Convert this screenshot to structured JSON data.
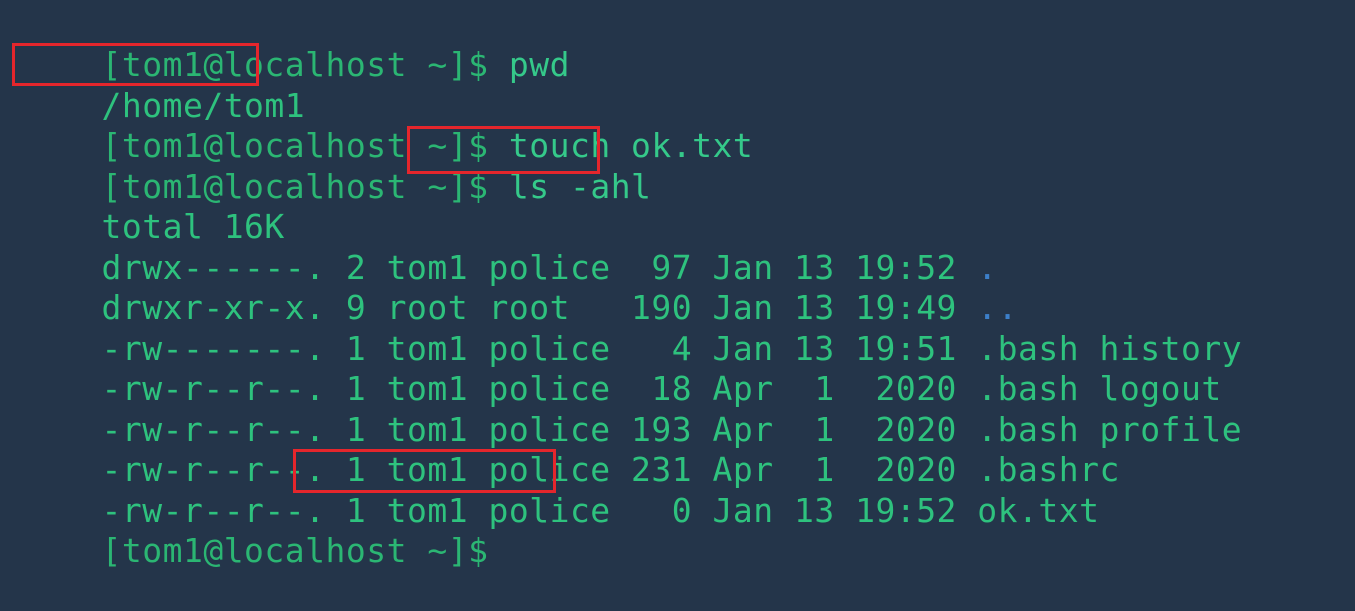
{
  "terminal": {
    "lines": [
      {
        "prompt": "[tom1@localhost ~]$",
        "command": " pwd"
      },
      {
        "output": "/home/tom1"
      },
      {
        "prompt": "[tom1@localhost ~]$",
        "command": " touch ok.txt"
      },
      {
        "prompt": "[tom1@localhost ~]$",
        "command": " ls -ahl"
      },
      {
        "output": "total 16K"
      },
      {
        "output": "drwx------. 2 tom1 police  97 Jan 13 19:52 ",
        "name": "."
      },
      {
        "output": "drwxr-xr-x. 9 root root   190 Jan 13 19:49 ",
        "name": ".."
      },
      {
        "output": "-rw-------. 1 tom1 police   4 Jan 13 19:51 .bash history"
      },
      {
        "output": "-rw-r--r--. 1 tom1 police  18 Apr  1  2020 .bash logout"
      },
      {
        "output": "-rw-r--r--. 1 tom1 police 193 Apr  1  2020 .bash profile"
      },
      {
        "output": "-rw-r--r--. 1 tom1 police 231 Apr  1  2020 .bashrc"
      },
      {
        "output": "-rw-r--r--. 1 tom1 police   0 Jan 13 19:52 ok.txt"
      },
      {
        "prompt": "[tom1@localhost ~]$",
        "command": ""
      }
    ]
  },
  "colors": {
    "background": "#24354a",
    "text": "#2ec27e",
    "directory": "#3c7fc9",
    "highlight_box": "#e5262c"
  }
}
